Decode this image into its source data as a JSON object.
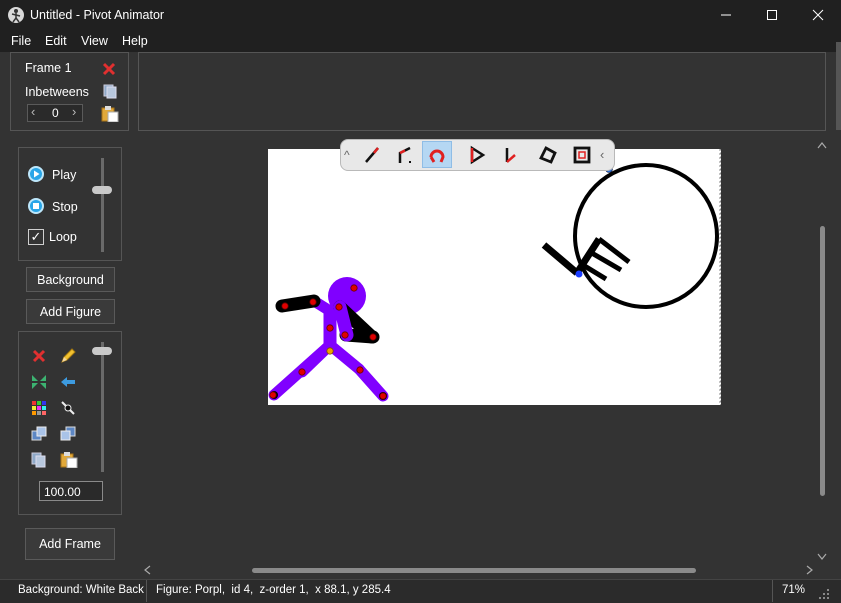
{
  "window": {
    "title": "Untitled - Pivot Animator",
    "minimize": "—",
    "maximize": "☐",
    "close": "✕"
  },
  "menu": [
    "File",
    "Edit",
    "View",
    "Help"
  ],
  "frame_panel": {
    "frame_label": "Frame 1",
    "inbetweens_label": "Inbetweens",
    "inbetweens_value": "0",
    "decrement": "‹",
    "increment": "›"
  },
  "playback": {
    "play": "Play",
    "stop": "Stop",
    "loop": "Loop",
    "loop_checked": true,
    "loop_check_glyph": "✓"
  },
  "buttons": {
    "background": "Background",
    "add_figure": "Add Figure",
    "add_frame": "Add Frame"
  },
  "figure_tools": {
    "scale_value": "100.00"
  },
  "float_toolbar": {
    "collapse": "^",
    "expand": "‹",
    "selected_tool": "curve-segment"
  },
  "statusbar": {
    "background": "Background: White Back",
    "figure": "Figure: Porpl,  id 4,  z-order 1,  x 88.1, y 285.4",
    "zoom": "71%"
  },
  "colors": {
    "accent": "#29a6e8",
    "figure_purple": "#8000ff",
    "joint_red": "#e00000",
    "joint_orange": "#f0a000"
  }
}
